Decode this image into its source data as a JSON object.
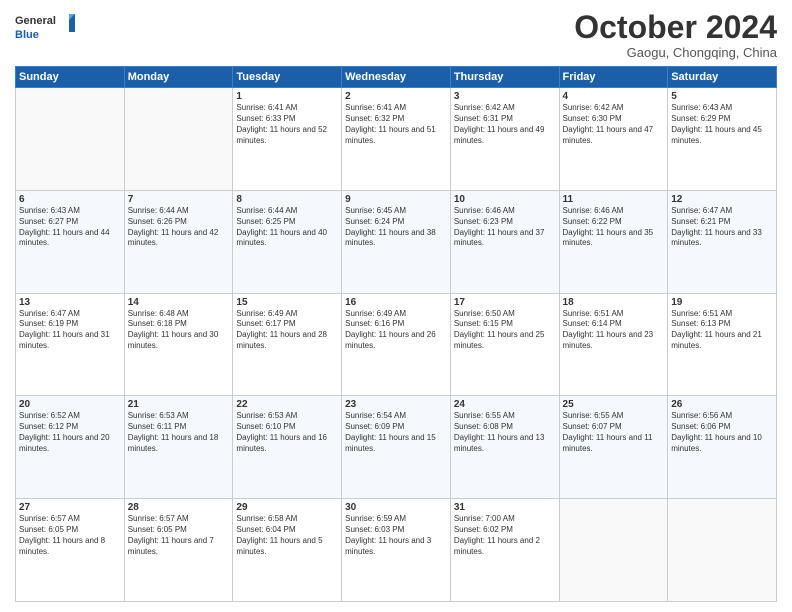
{
  "logo": {
    "line1": "General",
    "line2": "Blue"
  },
  "title": "October 2024",
  "subtitle": "Gaogu, Chongqing, China",
  "weekdays": [
    "Sunday",
    "Monday",
    "Tuesday",
    "Wednesday",
    "Thursday",
    "Friday",
    "Saturday"
  ],
  "weeks": [
    [
      {
        "day": "",
        "info": ""
      },
      {
        "day": "",
        "info": ""
      },
      {
        "day": "1",
        "info": "Sunrise: 6:41 AM\nSunset: 6:33 PM\nDaylight: 11 hours and 52 minutes."
      },
      {
        "day": "2",
        "info": "Sunrise: 6:41 AM\nSunset: 6:32 PM\nDaylight: 11 hours and 51 minutes."
      },
      {
        "day": "3",
        "info": "Sunrise: 6:42 AM\nSunset: 6:31 PM\nDaylight: 11 hours and 49 minutes."
      },
      {
        "day": "4",
        "info": "Sunrise: 6:42 AM\nSunset: 6:30 PM\nDaylight: 11 hours and 47 minutes."
      },
      {
        "day": "5",
        "info": "Sunrise: 6:43 AM\nSunset: 6:29 PM\nDaylight: 11 hours and 45 minutes."
      }
    ],
    [
      {
        "day": "6",
        "info": "Sunrise: 6:43 AM\nSunset: 6:27 PM\nDaylight: 11 hours and 44 minutes."
      },
      {
        "day": "7",
        "info": "Sunrise: 6:44 AM\nSunset: 6:26 PM\nDaylight: 11 hours and 42 minutes."
      },
      {
        "day": "8",
        "info": "Sunrise: 6:44 AM\nSunset: 6:25 PM\nDaylight: 11 hours and 40 minutes."
      },
      {
        "day": "9",
        "info": "Sunrise: 6:45 AM\nSunset: 6:24 PM\nDaylight: 11 hours and 38 minutes."
      },
      {
        "day": "10",
        "info": "Sunrise: 6:46 AM\nSunset: 6:23 PM\nDaylight: 11 hours and 37 minutes."
      },
      {
        "day": "11",
        "info": "Sunrise: 6:46 AM\nSunset: 6:22 PM\nDaylight: 11 hours and 35 minutes."
      },
      {
        "day": "12",
        "info": "Sunrise: 6:47 AM\nSunset: 6:21 PM\nDaylight: 11 hours and 33 minutes."
      }
    ],
    [
      {
        "day": "13",
        "info": "Sunrise: 6:47 AM\nSunset: 6:19 PM\nDaylight: 11 hours and 31 minutes."
      },
      {
        "day": "14",
        "info": "Sunrise: 6:48 AM\nSunset: 6:18 PM\nDaylight: 11 hours and 30 minutes."
      },
      {
        "day": "15",
        "info": "Sunrise: 6:49 AM\nSunset: 6:17 PM\nDaylight: 11 hours and 28 minutes."
      },
      {
        "day": "16",
        "info": "Sunrise: 6:49 AM\nSunset: 6:16 PM\nDaylight: 11 hours and 26 minutes."
      },
      {
        "day": "17",
        "info": "Sunrise: 6:50 AM\nSunset: 6:15 PM\nDaylight: 11 hours and 25 minutes."
      },
      {
        "day": "18",
        "info": "Sunrise: 6:51 AM\nSunset: 6:14 PM\nDaylight: 11 hours and 23 minutes."
      },
      {
        "day": "19",
        "info": "Sunrise: 6:51 AM\nSunset: 6:13 PM\nDaylight: 11 hours and 21 minutes."
      }
    ],
    [
      {
        "day": "20",
        "info": "Sunrise: 6:52 AM\nSunset: 6:12 PM\nDaylight: 11 hours and 20 minutes."
      },
      {
        "day": "21",
        "info": "Sunrise: 6:53 AM\nSunset: 6:11 PM\nDaylight: 11 hours and 18 minutes."
      },
      {
        "day": "22",
        "info": "Sunrise: 6:53 AM\nSunset: 6:10 PM\nDaylight: 11 hours and 16 minutes."
      },
      {
        "day": "23",
        "info": "Sunrise: 6:54 AM\nSunset: 6:09 PM\nDaylight: 11 hours and 15 minutes."
      },
      {
        "day": "24",
        "info": "Sunrise: 6:55 AM\nSunset: 6:08 PM\nDaylight: 11 hours and 13 minutes."
      },
      {
        "day": "25",
        "info": "Sunrise: 6:55 AM\nSunset: 6:07 PM\nDaylight: 11 hours and 11 minutes."
      },
      {
        "day": "26",
        "info": "Sunrise: 6:56 AM\nSunset: 6:06 PM\nDaylight: 11 hours and 10 minutes."
      }
    ],
    [
      {
        "day": "27",
        "info": "Sunrise: 6:57 AM\nSunset: 6:05 PM\nDaylight: 11 hours and 8 minutes."
      },
      {
        "day": "28",
        "info": "Sunrise: 6:57 AM\nSunset: 6:05 PM\nDaylight: 11 hours and 7 minutes."
      },
      {
        "day": "29",
        "info": "Sunrise: 6:58 AM\nSunset: 6:04 PM\nDaylight: 11 hours and 5 minutes."
      },
      {
        "day": "30",
        "info": "Sunrise: 6:59 AM\nSunset: 6:03 PM\nDaylight: 11 hours and 3 minutes."
      },
      {
        "day": "31",
        "info": "Sunrise: 7:00 AM\nSunset: 6:02 PM\nDaylight: 11 hours and 2 minutes."
      },
      {
        "day": "",
        "info": ""
      },
      {
        "day": "",
        "info": ""
      }
    ]
  ]
}
